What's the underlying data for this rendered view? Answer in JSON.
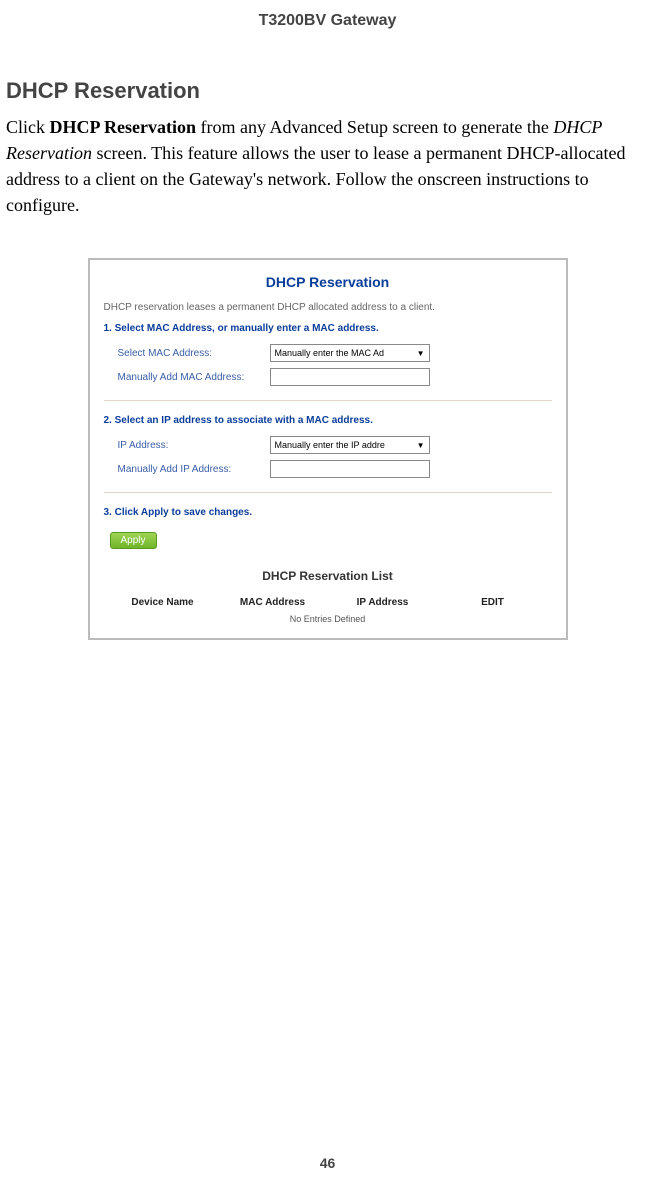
{
  "header": {
    "title": "T3200BV Gateway"
  },
  "section": {
    "heading": "DHCP Reservation",
    "p_click": "Click ",
    "p_bold": "DHCP Reservation",
    "p_mid": " from any Advanced Setup screen to generate the ",
    "p_italic": "DHCP Reservation",
    "p_end": " screen. This feature allows the user to lease a permanent DHCP-allocated address to a client on the Gateway's network. Follow the onscreen instructions to configure."
  },
  "ui": {
    "title": "DHCP Reservation",
    "desc": "DHCP reservation leases a permanent DHCP allocated address to a client.",
    "step1": "1. Select MAC Address, or manually enter a MAC address.",
    "select_mac_label": "Select MAC Address:",
    "select_mac_value": "Manually enter the MAC Ad",
    "manual_mac_label": "Manually Add MAC Address:",
    "step2": "2. Select an IP address to associate with a MAC address.",
    "ip_label": "IP Address:",
    "ip_value": "Manually enter the IP addre",
    "manual_ip_label": "Manually Add IP Address:",
    "step3": "3. Click Apply to save changes.",
    "apply": "Apply",
    "list_title": "DHCP Reservation List",
    "cols": {
      "c1": "Device Name",
      "c2": "MAC Address",
      "c3": "IP Address",
      "c4": "EDIT"
    },
    "no_entries": "No Entries Defined"
  },
  "footer": {
    "page": "46"
  }
}
